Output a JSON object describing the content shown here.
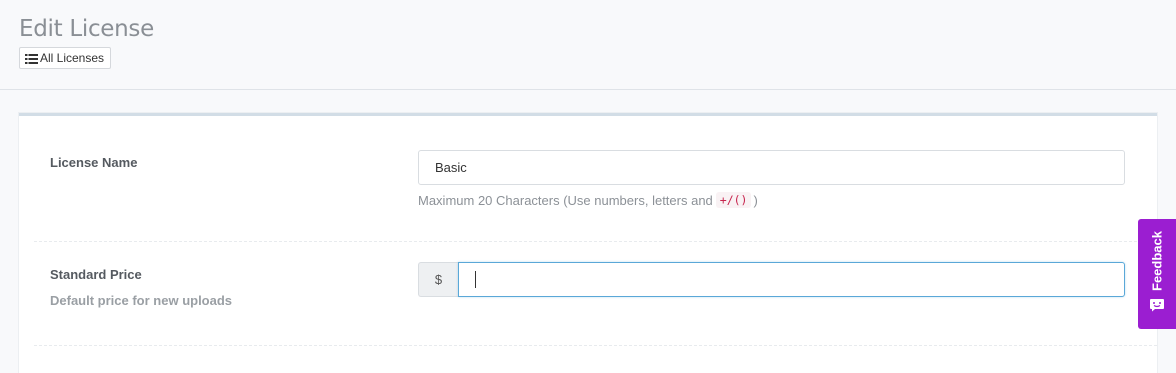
{
  "header": {
    "title": "Edit License",
    "all_licenses_label": "All Licenses",
    "list_icon": "list-icon"
  },
  "form": {
    "license_name": {
      "label": "License Name",
      "value": "Basic",
      "help_text": "Maximum 20 Characters (Use numbers, letters and",
      "help_code": "+/()",
      "help_suffix": ")"
    },
    "standard_price": {
      "label": "Standard Price",
      "sublabel": "Default price for new uploads",
      "currency_symbol": "$",
      "value": ""
    }
  },
  "feedback": {
    "label": "Feedback",
    "icon": "chat-bubble-icon",
    "color": "#9b1ed1"
  }
}
